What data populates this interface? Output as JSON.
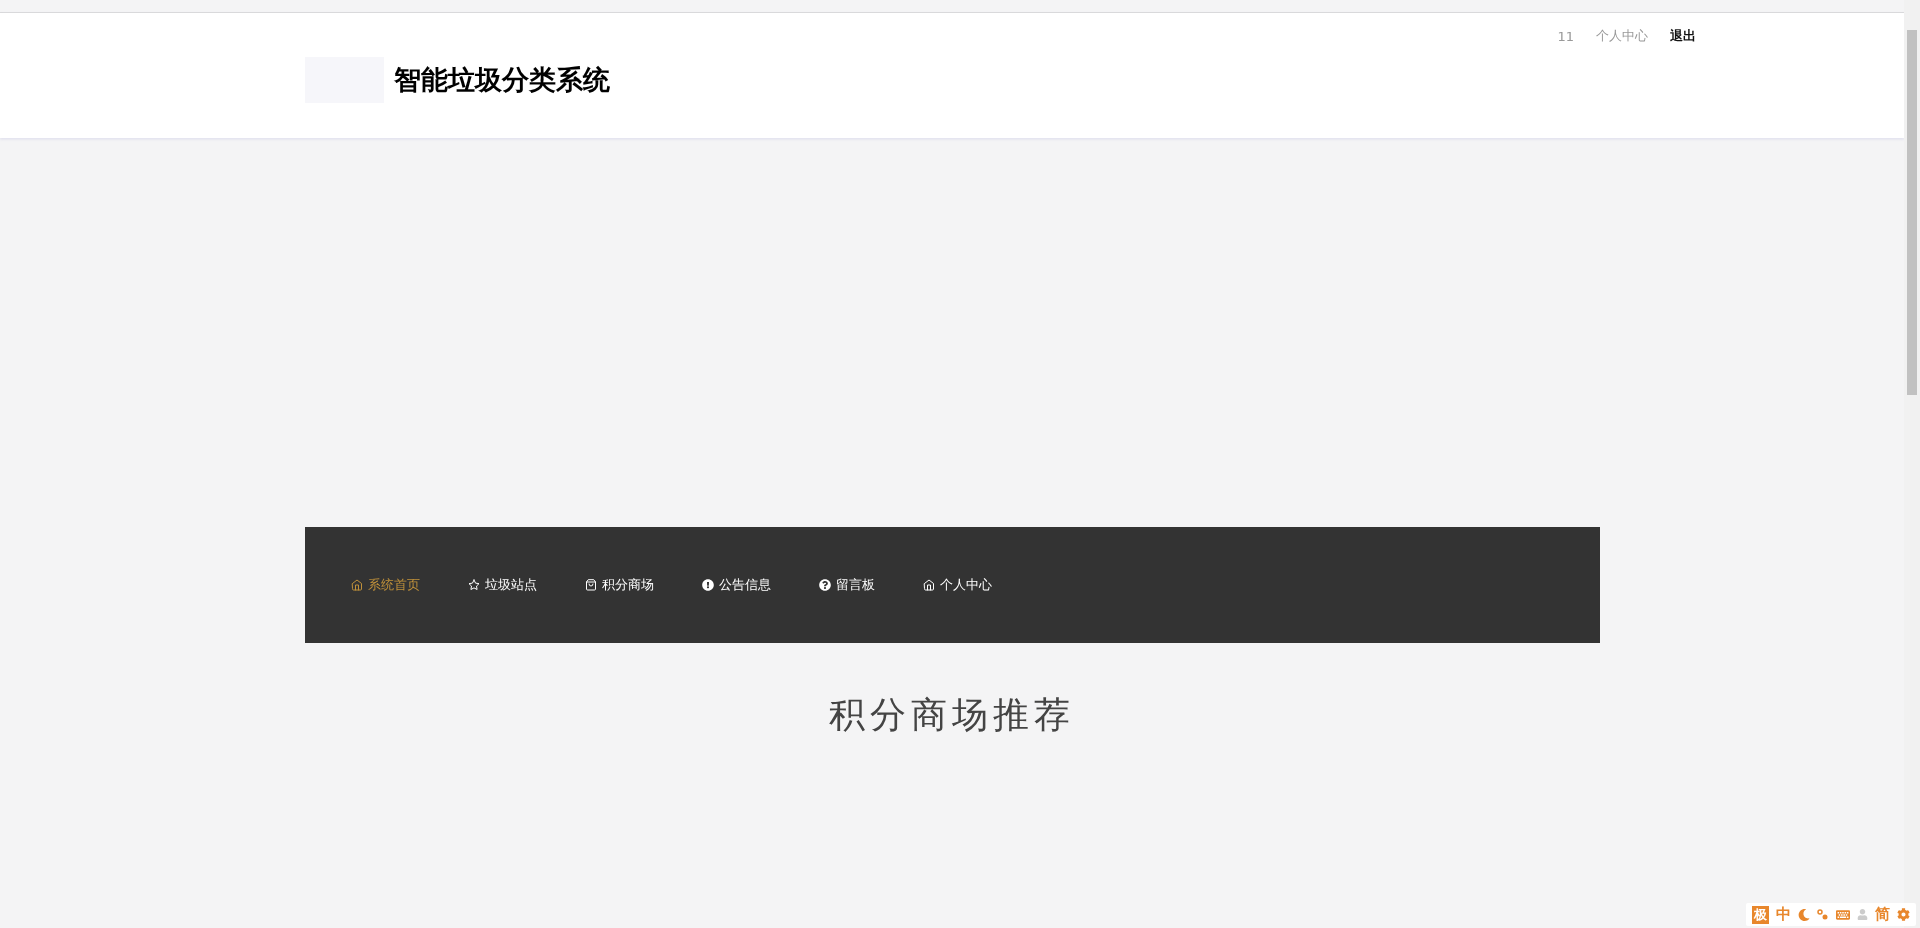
{
  "top_links": {
    "user": "11",
    "profile": "个人中心",
    "logout": "退出"
  },
  "header": {
    "title": "智能垃圾分类系统"
  },
  "nav": [
    {
      "label": "系统首页",
      "selected": true
    },
    {
      "label": "垃圾站点",
      "selected": false
    },
    {
      "label": "积分商场",
      "selected": false
    },
    {
      "label": "公告信息",
      "selected": false
    },
    {
      "label": "留言板",
      "selected": false
    },
    {
      "label": "个人中心",
      "selected": false
    }
  ],
  "section": {
    "title": "积分商场推荐"
  },
  "ime_toolbar": {
    "badge": "极",
    "mode": "中",
    "script": "简"
  }
}
